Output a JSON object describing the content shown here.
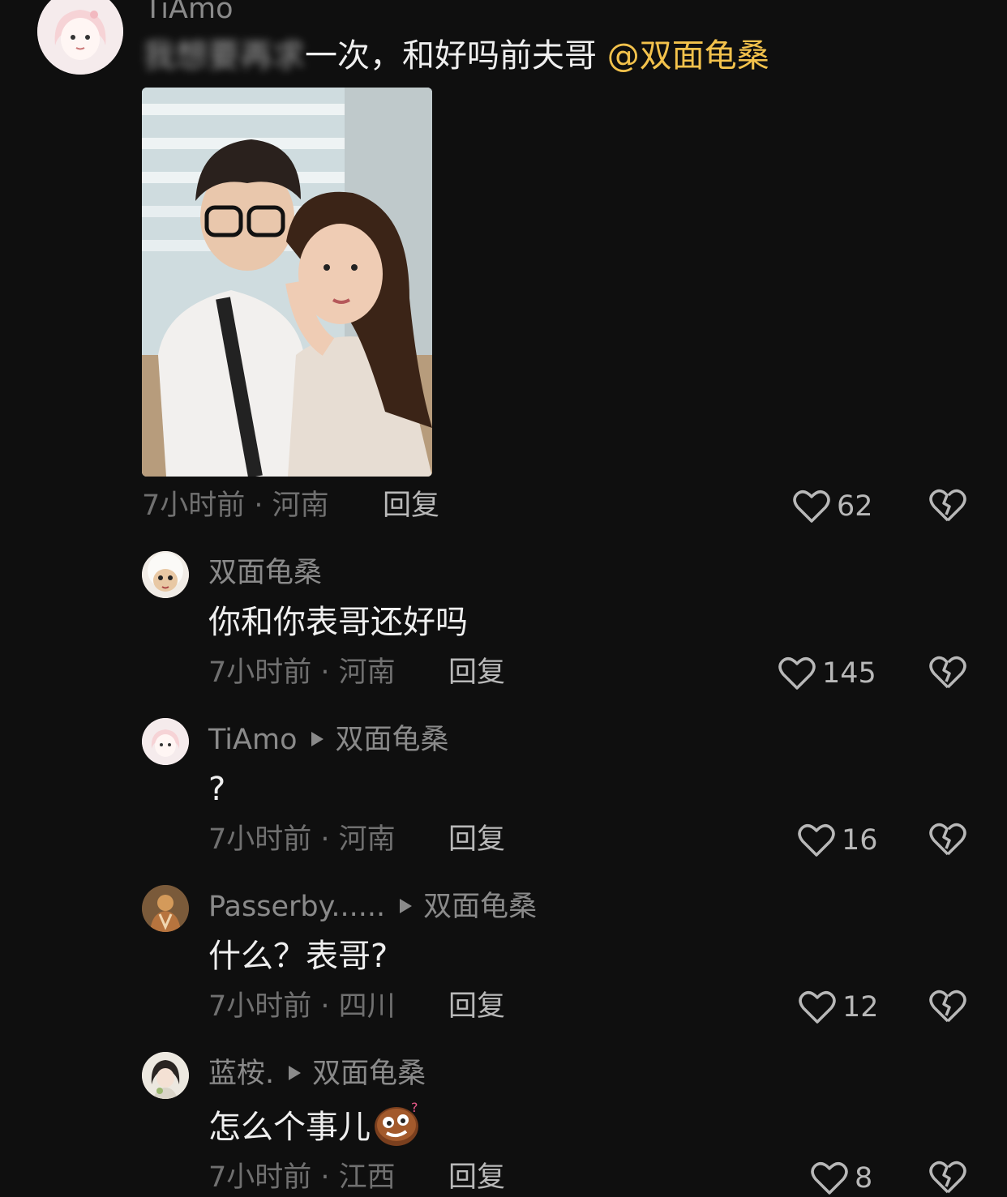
{
  "main_comment": {
    "username": "TiAmo",
    "content_blurred": "我想要再求",
    "content": "一次，和好吗前夫哥",
    "mention": "@双面龟桑",
    "time": "7小时前",
    "location": "河南",
    "meta_sep": " · ",
    "reply_label": "回复",
    "likes": "62"
  },
  "replies": [
    {
      "username": "双面龟桑",
      "reply_to": "",
      "content": "你和你表哥还好吗",
      "time": "7小时前",
      "location": "河南",
      "reply_label": "回复",
      "likes": "145"
    },
    {
      "username": "TiAmo",
      "reply_to": "双面龟桑",
      "content": "?",
      "time": "7小时前",
      "location": "河南",
      "reply_label": "回复",
      "likes": "16"
    },
    {
      "username": "Passerby......",
      "reply_to": "双面龟桑",
      "content": "什么？表哥?",
      "time": "7小时前",
      "location": "四川",
      "reply_label": "回复",
      "likes": "12"
    },
    {
      "username": "蓝桉.",
      "reply_to": "双面龟桑",
      "content": "怎么个事儿",
      "time": "7小时前",
      "location": "江西",
      "reply_label": "回复",
      "likes": "8"
    }
  ],
  "colors": {
    "background": "#0f0f0f",
    "mention": "#f3c24c",
    "username": "#8a8a8a",
    "meta": "#707070"
  },
  "icons": [
    "heart-outline-icon",
    "broken-heart-icon",
    "play-arrow-icon",
    "emoji-sticker-icon"
  ]
}
